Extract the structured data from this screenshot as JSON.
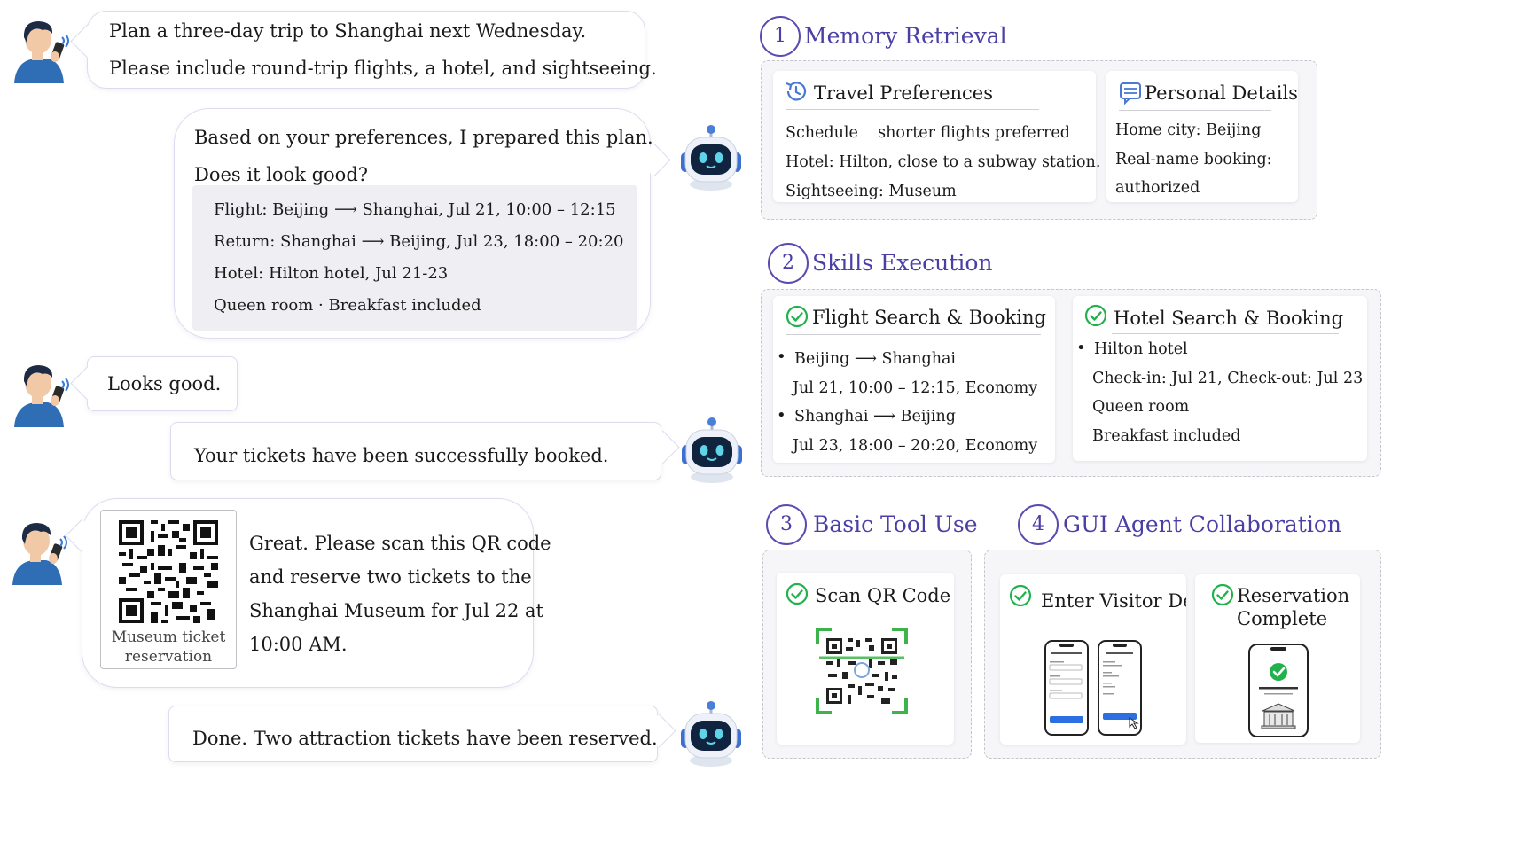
{
  "chat": {
    "user_request": [
      "Plan a three-day trip to Shanghai next Wednesday.",
      "Please include round-trip flights, a hotel, and sightseeing."
    ],
    "bot_plan_intro": [
      "Based on your preferences, I prepared this plan.",
      "Does it look good?"
    ],
    "bot_plan_details": [
      "Flight: Beijing ⟶ Shanghai, Jul 21, 10:00 – 12:15",
      "Return: Shanghai ⟶ Beijing, Jul 23, 18:00 – 20:20",
      "Hotel: Hilton hotel, Jul 21-23",
      "Queen room · Breakfast included"
    ],
    "user_confirm": "Looks good.",
    "bot_booked": "Your tickets have been successfully booked.",
    "qr_caption": [
      "Museum ticket",
      "reservation"
    ],
    "user_museum": [
      "Great. Please scan this QR code",
      "and reserve two tickets to the",
      "Shanghai Museum for Jul 22 at",
      "10:00 AM."
    ],
    "bot_done": "Done. Two attraction tickets have been reserved."
  },
  "steps": {
    "s1": {
      "num": "1",
      "title": "Memory Retrieval"
    },
    "s2": {
      "num": "2",
      "title": "Skills Execution"
    },
    "s3": {
      "num": "3",
      "title": "Basic Tool Use"
    },
    "s4": {
      "num": "4",
      "title": "GUI Agent Collaboration"
    }
  },
  "memory": {
    "travel_title": "Travel Preferences",
    "travel_lines": [
      "Schedule    shorter flights preferred",
      "Hotel: Hilton, close to a subway station.",
      "Sightseeing: Museum"
    ],
    "personal_title": "Personal Details",
    "personal_lines": [
      "Home city: Beijing",
      "Real-name booking:",
      "authorized"
    ]
  },
  "skills": {
    "flight_title": "Flight Search & Booking",
    "flight_lines": [
      "Beijing ⟶ Shanghai",
      "Jul 21, 10:00 – 12:15, Economy",
      "Shanghai ⟶ Beijing",
      "Jul 23, 18:00 – 20:20, Economy"
    ],
    "hotel_title": "Hotel Search & Booking",
    "hotel_lines": [
      "Hilton hotel",
      "Check-in: Jul 21,  Check-out: Jul 23",
      "Queen room",
      "Breakfast included"
    ]
  },
  "tools": {
    "scan_title": "Scan QR Code"
  },
  "gui": {
    "visitor_title": "Enter Visitor Details",
    "complete_title": [
      "Reservation",
      "Complete"
    ]
  },
  "colors": {
    "accent": "#4b3fa6",
    "check": "#22b14c",
    "user_shirt": "#2f6db5",
    "bot_eye": "#5fd3e8"
  }
}
